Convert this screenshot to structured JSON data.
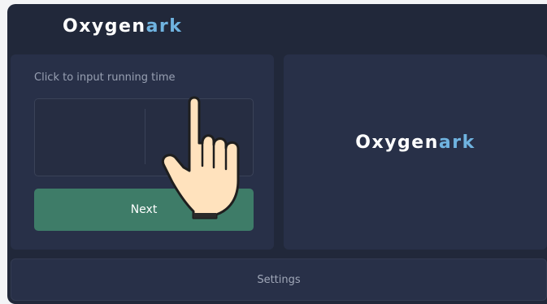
{
  "header": {
    "logo_word": "Oxygen",
    "logo_accent": "ark"
  },
  "left_panel": {
    "prompt": "Click to input running time",
    "next_label": "Next"
  },
  "right_panel": {
    "logo_word": "Oxygen",
    "logo_accent": "ark"
  },
  "footer": {
    "settings_label": "Settings"
  },
  "icons": {
    "pointer": "hand-pointer-icon"
  },
  "colors": {
    "background": "#21283a",
    "panel": "#283048",
    "accent": "#6fb3e0",
    "button": "#3e7c68"
  }
}
